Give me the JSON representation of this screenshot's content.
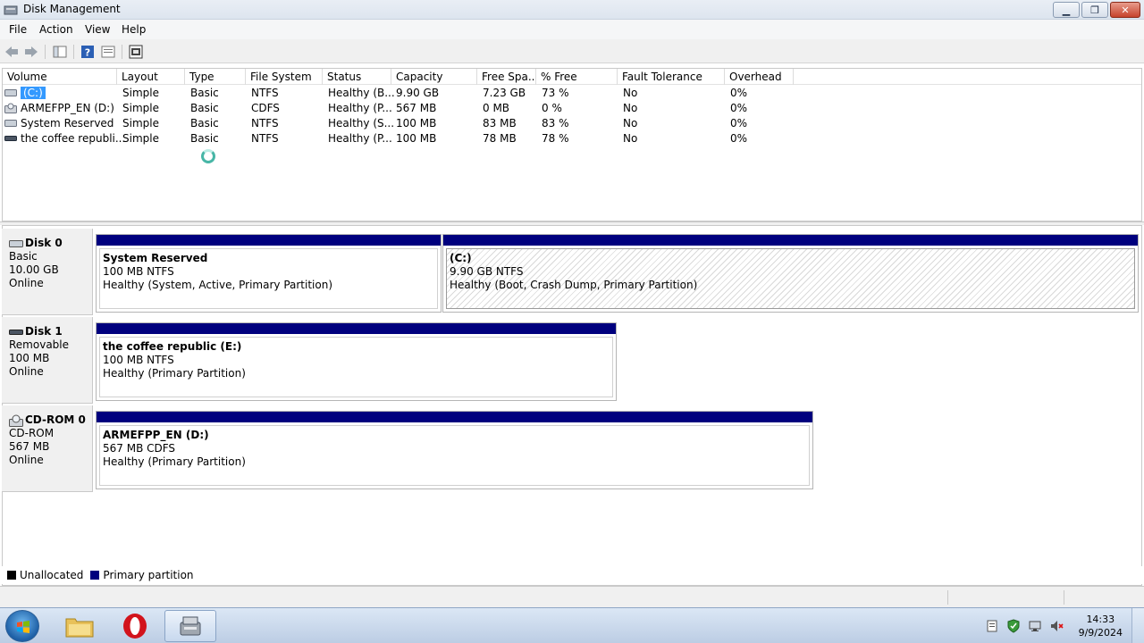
{
  "window": {
    "title": "Disk Management",
    "min_label": "▁",
    "max_label": "❐",
    "close_label": "✕"
  },
  "menu": [
    "File",
    "Action",
    "View",
    "Help"
  ],
  "toolbar": {
    "back_icon": "back-arrow-icon",
    "forward_icon": "forward-arrow-icon",
    "console_tree_icon": "console-tree-icon",
    "help_icon": "help-icon",
    "properties_icon": "properties-icon",
    "rescan_icon": "rescan-disks-icon"
  },
  "volume_list": {
    "columns": [
      "Volume",
      "Layout",
      "Type",
      "File System",
      "Status",
      "Capacity",
      "Free Spa...",
      "% Free",
      "Fault Tolerance",
      "Overhead"
    ],
    "rows": [
      {
        "volume": "(C:)",
        "layout": "Simple",
        "type": "Basic",
        "fs": "NTFS",
        "status": "Healthy (B...",
        "capacity": "9.90 GB",
        "free": "7.23 GB",
        "pct": "73 %",
        "fault": "No",
        "overhead": "0%",
        "icon": "volume-icon"
      },
      {
        "volume": "ARMEFPP_EN (D:)",
        "layout": "Simple",
        "type": "Basic",
        "fs": "CDFS",
        "status": "Healthy (P...",
        "capacity": "567 MB",
        "free": "0 MB",
        "pct": "0 %",
        "fault": "No",
        "overhead": "0%",
        "icon": "cd-drive-icon"
      },
      {
        "volume": "System Reserved",
        "layout": "Simple",
        "type": "Basic",
        "fs": "NTFS",
        "status": "Healthy (S...",
        "capacity": "100 MB",
        "free": "83 MB",
        "pct": "83 %",
        "fault": "No",
        "overhead": "0%",
        "icon": "volume-icon"
      },
      {
        "volume": "the coffee republi...",
        "layout": "Simple",
        "type": "Basic",
        "fs": "NTFS",
        "status": "Healthy (P...",
        "capacity": "100 MB",
        "free": "78 MB",
        "pct": "78 %",
        "fault": "No",
        "overhead": "0%",
        "icon": "removable-drive-icon"
      }
    ]
  },
  "disks": [
    {
      "name": "Disk 0",
      "kind": "Basic",
      "size": "10.00 GB",
      "state": "Online",
      "icon": "hard-disk-icon",
      "partitions": [
        {
          "name": "System Reserved",
          "size": "100 MB NTFS",
          "status": "Healthy (System, Active, Primary Partition)"
        },
        {
          "name": "(C:)",
          "size": "9.90 GB NTFS",
          "status": "Healthy (Boot, Crash Dump, Primary Partition)"
        }
      ]
    },
    {
      "name": "Disk 1",
      "kind": "Removable",
      "size": "100 MB",
      "state": "Online",
      "icon": "removable-disk-icon",
      "partitions": [
        {
          "name": "the coffee republic  (E:)",
          "size": "100 MB NTFS",
          "status": "Healthy (Primary Partition)"
        }
      ]
    },
    {
      "name": "CD-ROM 0",
      "kind": "CD-ROM",
      "size": "567 MB",
      "state": "Online",
      "icon": "cd-rom-icon",
      "partitions": [
        {
          "name": "ARMEFPP_EN  (D:)",
          "size": "567 MB CDFS",
          "status": "Healthy (Primary Partition)"
        }
      ]
    }
  ],
  "legend": [
    {
      "label": "Unallocated",
      "color": "#000000"
    },
    {
      "label": "Primary partition",
      "color": "#00007e"
    }
  ],
  "taskbar": {
    "apps": [
      "explorer-folder-icon",
      "opera-browser-icon",
      "disk-management-icon"
    ],
    "tray": [
      "action-center-icon",
      "security-shield-icon",
      "network-icon",
      "volume-muted-icon"
    ],
    "time": "14:33",
    "date": "9/9/2024"
  },
  "colors": {
    "partition_bar": "#00007e",
    "selection": "#3399ff"
  }
}
